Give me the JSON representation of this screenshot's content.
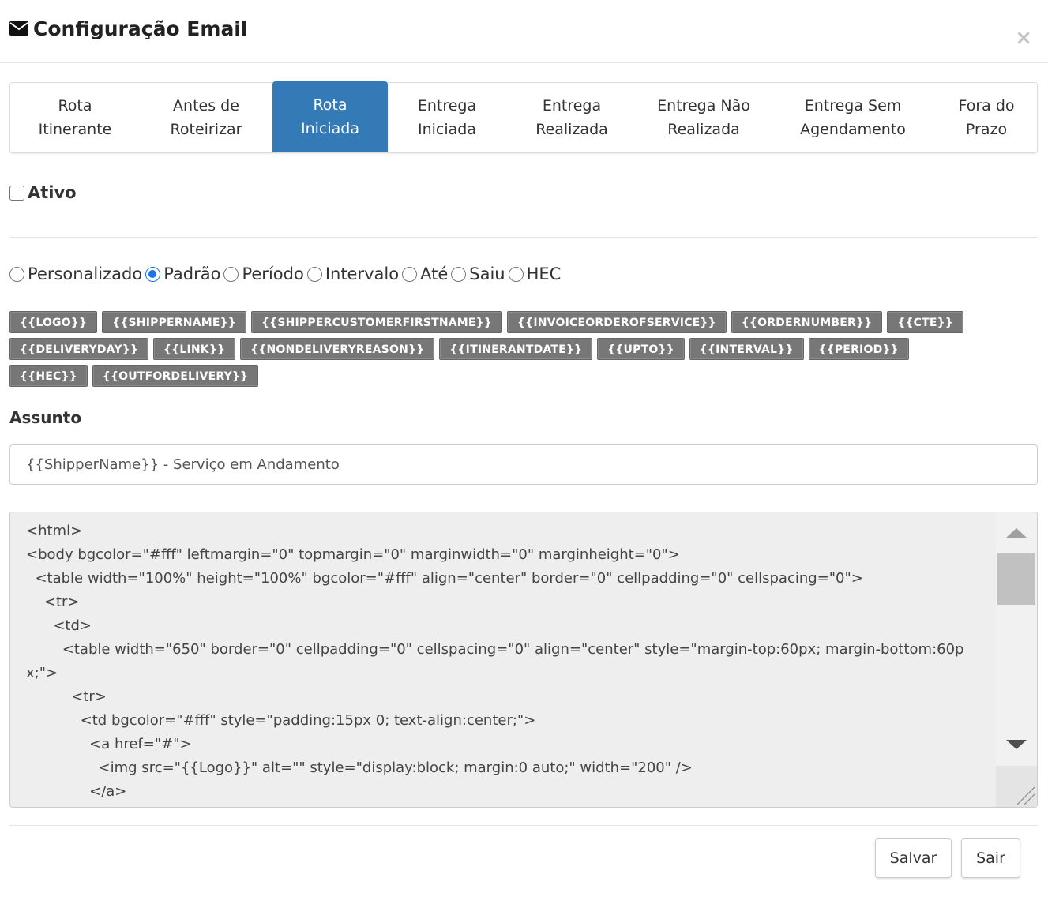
{
  "modal": {
    "title": "Configuração Email",
    "close_symbol": "×",
    "title_icon": "envelope-icon"
  },
  "tabs": [
    {
      "label": "Rota\nItinerante",
      "active": false
    },
    {
      "label": "Antes de\nRoteirizar",
      "active": false
    },
    {
      "label": "Rota\nIniciada",
      "active": true
    },
    {
      "label": "Entrega\nIniciada",
      "active": false
    },
    {
      "label": "Entrega\nRealizada",
      "active": false
    },
    {
      "label": "Entrega Não\nRealizada",
      "active": false
    },
    {
      "label": "Entrega Sem\nAgendamento",
      "active": false
    },
    {
      "label": "Fora do\nPrazo",
      "active": false
    }
  ],
  "ativo": {
    "label": "Ativo",
    "checked": false
  },
  "radios": [
    {
      "label": "Personalizado",
      "checked": false
    },
    {
      "label": "Padrão",
      "checked": true
    },
    {
      "label": "Período",
      "checked": false
    },
    {
      "label": "Intervalo",
      "checked": false
    },
    {
      "label": "Até",
      "checked": false
    },
    {
      "label": "Saiu",
      "checked": false
    },
    {
      "label": "HEC",
      "checked": false
    }
  ],
  "tags": [
    "{{LOGO}}",
    "{{SHIPPERNAME}}",
    "{{SHIPPERCUSTOMERFIRSTNAME}}",
    "{{INVOICEORDEROFSERVICE}}",
    "{{ORDERNUMBER}}",
    "{{CTE}}",
    "{{DELIVERYDAY}}",
    "{{LINK}}",
    "{{NONDELIVERYREASON}}",
    "{{ITINERANTDATE}}",
    "{{UPTO}}",
    "{{INTERVAL}}",
    "{{PERIOD}}",
    "{{HEC}}",
    "{{OUTFORDELIVERY}}"
  ],
  "assunto": {
    "label": "Assunto",
    "value": "{{ShipperName}} - Serviço em Andamento"
  },
  "body_html": "<html>\n<body bgcolor=\"#fff\" leftmargin=\"0\" topmargin=\"0\" marginwidth=\"0\" marginheight=\"0\">\n  <table width=\"100%\" height=\"100%\" bgcolor=\"#fff\" align=\"center\" border=\"0\" cellpadding=\"0\" cellspacing=\"0\">\n    <tr>\n      <td>\n        <table width=\"650\" border=\"0\" cellpadding=\"0\" cellspacing=\"0\" align=\"center\" style=\"margin-top:60px; margin-bottom:60px;\">\n          <tr>\n            <td bgcolor=\"#fff\" style=\"padding:15px 0; text-align:center;\">\n              <a href=\"#\">\n                <img src=\"{{Logo}}\" alt=\"\" style=\"display:block; margin:0 auto;\" width=\"200\" />\n              </a>",
  "buttons": {
    "save": "Salvar",
    "exit": "Sair"
  },
  "colors": {
    "accent": "#337ab7",
    "tag_bg": "#777777"
  }
}
